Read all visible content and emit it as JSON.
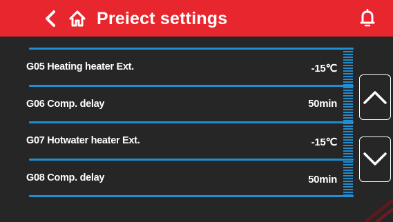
{
  "header": {
    "title": "Preiect settings",
    "background_color": "#e8262d",
    "icons": [
      "chevron-left-icon",
      "home-icon",
      "bell-icon"
    ]
  },
  "settings": [
    {
      "code_label": "G05 Heating heater Ext.",
      "value": "-15℃"
    },
    {
      "code_label": "G06 Comp. delay",
      "value": "50min"
    },
    {
      "code_label": "G07 Hotwater heater Ext.",
      "value": "-15℃"
    },
    {
      "code_label": "G08 Comp. delay",
      "value": "50min"
    }
  ],
  "navigation": {
    "up_icon": "chevron-up-icon",
    "down_icon": "chevron-down-icon"
  },
  "colors": {
    "accent": "#1f8fd2",
    "background": "#262626",
    "text": "#ffffff"
  }
}
